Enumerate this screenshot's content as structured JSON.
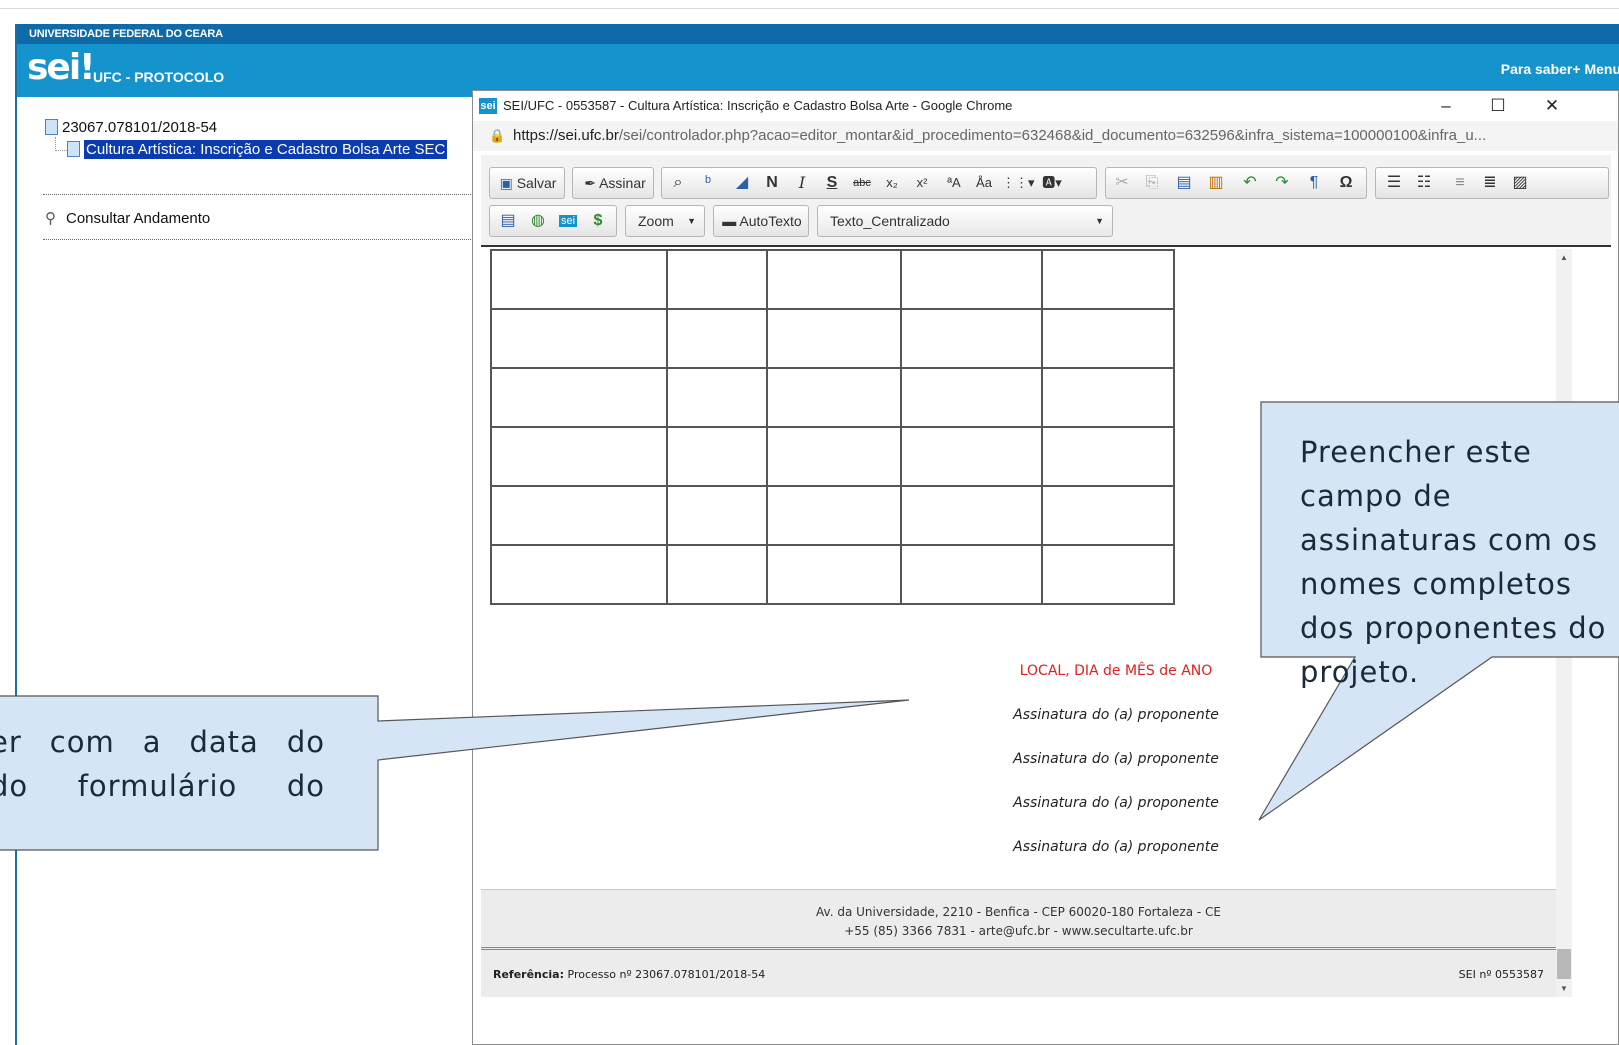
{
  "app": {
    "institution": "UNIVERSIDADE FEDERAL DO CEARA",
    "logo": "sei!",
    "unit": "UFC - PROTOCOLO",
    "help": "Para saber+  Menu"
  },
  "tree": {
    "process_number": "23067.078101/2018-54",
    "document_label": "Cultura Artística: Inscrição e Cadastro Bolsa Arte SEC",
    "consult_label": "Consultar Andamento"
  },
  "window": {
    "title": "SEI/UFC - 0553587 - Cultura Artística: Inscrição e Cadastro Bolsa Arte - Google Chrome",
    "url_host": "https://sei.ufc.br",
    "url_path": "/sei/controlador.php?acao=editor_montar&id_procedimento=632468&id_documento=632596&infra_sistema=100000100&infra_u...",
    "minimize": "–",
    "maximize": "☐",
    "close": "✕"
  },
  "toolbar": {
    "save": "Salvar",
    "sign": "Assinar",
    "zoom": "Zoom",
    "autotext": "AutoTexto",
    "style": "Texto_Centralizado",
    "bold": "N",
    "italic": "I",
    "strike": "S",
    "abc": "abc",
    "omega": "Ω",
    "pilcrow": "¶"
  },
  "document": {
    "table": {
      "rows": 6,
      "cols": 5
    },
    "date_line": "LOCAL, DIA de MÊS de ANO",
    "signatures": [
      "Assinatura do (a) proponente",
      "Assinatura do (a) proponente",
      "Assinatura do (a) proponente",
      "Assinatura do (a) proponente"
    ],
    "footer_address": "Av. da Universidade, 2210 - Benfica - CEP 60020-180 Fortaleza - CE",
    "footer_contact": "+55 (85) 3366 7831 - arte@ufc.br - www.secultarte.ufc.br",
    "reference_label": "Referência:",
    "reference_value": "Processo nº 23067.078101/2018-54",
    "sei_number": "SEI nº 0553587"
  },
  "callouts": {
    "left_line1": "er com a data do",
    "left_line2": "do formulário do",
    "right_text": "Preencher este campo de assinaturas com os nomes completos dos proponentes do projeto.",
    "fill_color": "#d6e5f5",
    "stroke_color": "#555555"
  }
}
